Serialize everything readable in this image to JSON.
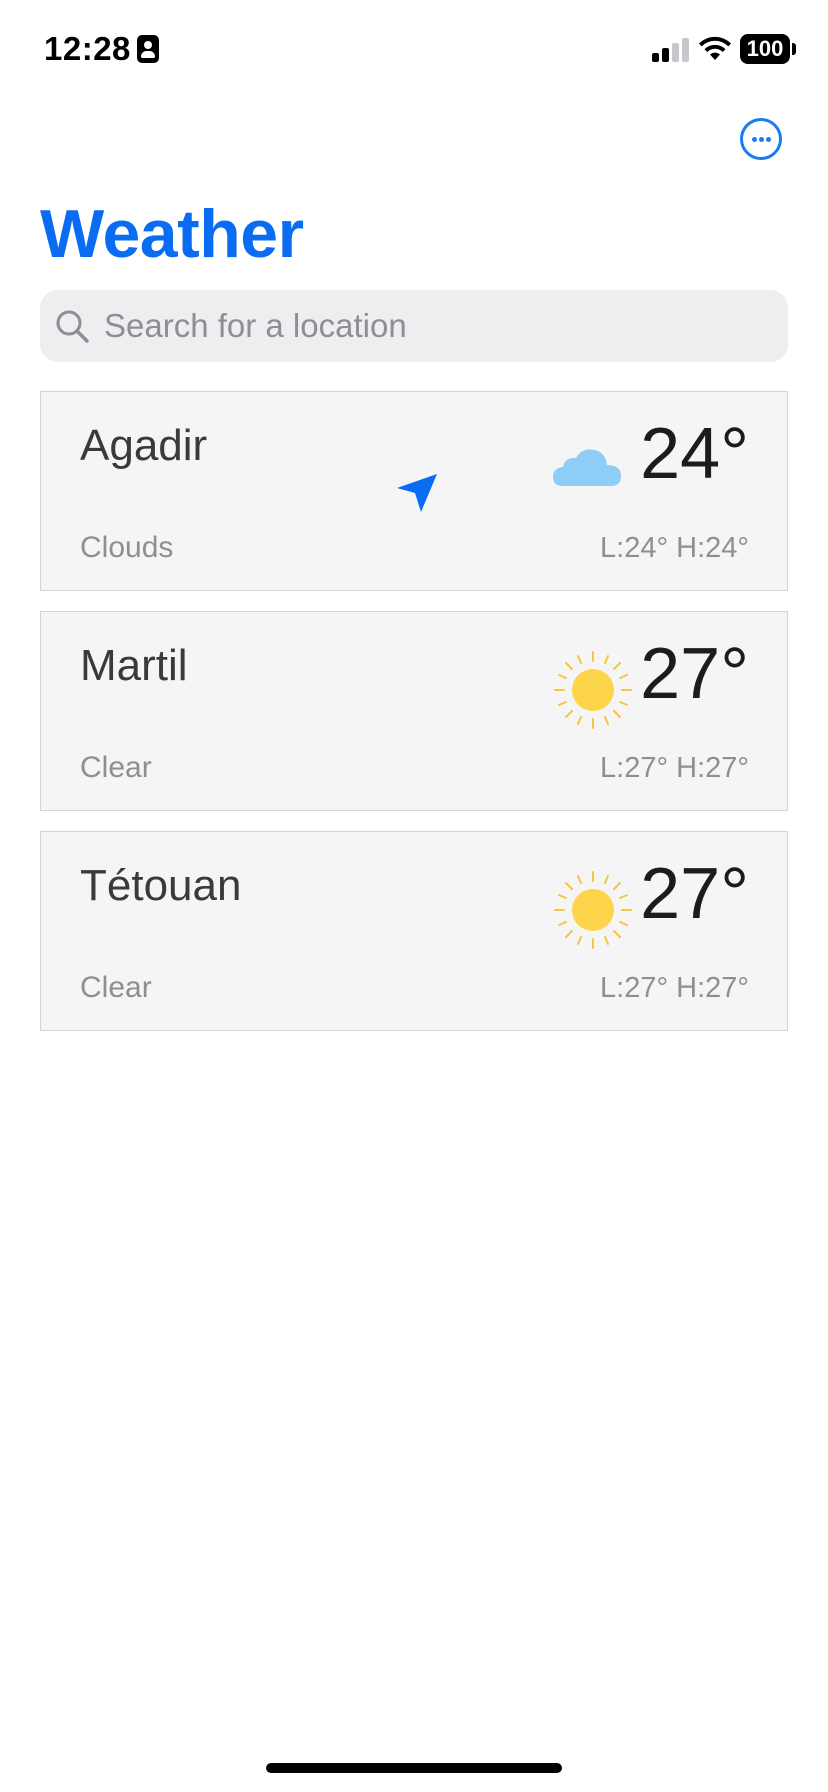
{
  "status_bar": {
    "time": "12:28",
    "battery": "100",
    "id_icon": "person-badge-icon",
    "signal_icon": "cellular-signal-icon",
    "wifi_icon": "wifi-icon"
  },
  "header": {
    "more_icon": "ellipsis-circle-icon",
    "title": "Weather",
    "accent_color": "#0a6cf2"
  },
  "search": {
    "placeholder": "Search for a location",
    "value": ""
  },
  "cities": [
    {
      "name": "Agadir",
      "condition": "Clouds",
      "temperature": "24°",
      "range": "L:24° H:24°",
      "icon": "cloud-icon",
      "current_location": true
    },
    {
      "name": "Martil",
      "condition": "Clear",
      "temperature": "27°",
      "range": "L:27° H:27°",
      "icon": "sun-icon",
      "current_location": false
    },
    {
      "name": "Tétouan",
      "condition": "Clear",
      "temperature": "27°",
      "range": "L:27° H:27°",
      "icon": "sun-icon",
      "current_location": false
    }
  ]
}
